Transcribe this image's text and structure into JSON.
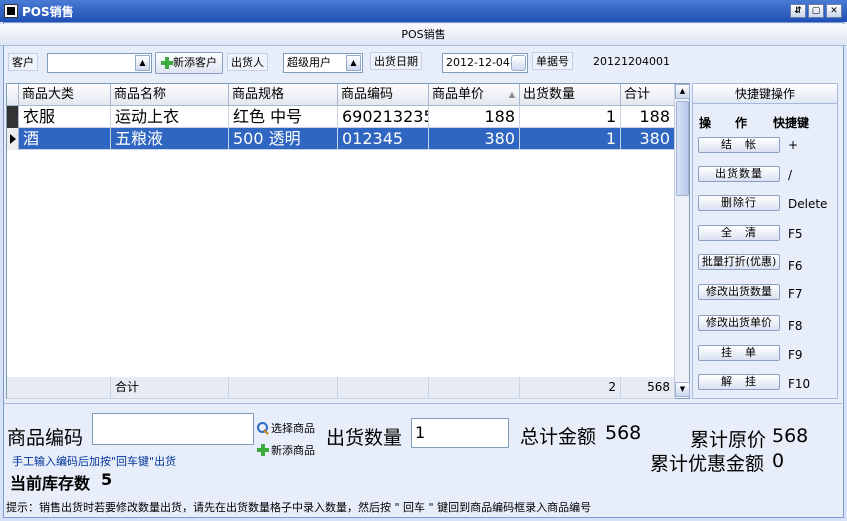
{
  "window": {
    "title": "POS销售",
    "controls": [
      "⇵",
      "▢",
      "✕"
    ]
  },
  "header": {
    "title": "POS销售"
  },
  "toolbar": {
    "customer_label": "客户",
    "customer_value": "",
    "add_customer_label": "新添客户",
    "shipper_label": "出货人",
    "shipper_value": "超级用户",
    "date_label": "出货日期",
    "date_value": "2012-12-04",
    "doc_no_label": "单据号",
    "doc_no_value": "20121204001"
  },
  "grid": {
    "columns": [
      "商品大类",
      "商品名称",
      "商品规格",
      "商品编码",
      "商品单价",
      "出货数量",
      "合计"
    ],
    "sort_indicator": "▲",
    "rows": [
      {
        "category": "衣服",
        "name": "运动上衣",
        "spec": "红色 中号",
        "code": "690213235",
        "price": "188",
        "qty": "1",
        "total": "188",
        "selected": false
      },
      {
        "category": "酒",
        "name": "五粮液",
        "spec": "500 透明",
        "code": "012345",
        "price": "380",
        "qty": "1",
        "total": "380",
        "selected": true
      }
    ],
    "summary": {
      "label": "合计",
      "qty": "2",
      "total": "568"
    }
  },
  "shortcuts": {
    "title": "快捷键操作",
    "col_action": "操　　作",
    "col_key": "快捷键",
    "items": [
      {
        "label": "结　帐",
        "key": "+"
      },
      {
        "label": "出货数量",
        "key": "/"
      },
      {
        "label": "删除行",
        "key": "Delete"
      },
      {
        "label": "全　清",
        "key": "F5"
      },
      {
        "label": "批量打折(优惠)",
        "key": "F6"
      },
      {
        "label": "修改出货数量",
        "key": "F7"
      },
      {
        "label": "修改出货单价",
        "key": "F8"
      },
      {
        "label": "挂　单",
        "key": "F9"
      },
      {
        "label": "解　挂",
        "key": "F10"
      }
    ]
  },
  "bottom": {
    "code_label": "商品编码",
    "code_value": "",
    "select_goods": "选择商品",
    "add_goods": "新添商品",
    "qty_label": "出货数量",
    "qty_value": "1",
    "total_label": "总计金额",
    "total_value": "568",
    "orig_label": "累计原价",
    "orig_value": "568",
    "discount_label": "累计优惠金额",
    "discount_value": "0",
    "hint": "手工输入编码后加按\"回车键\"出货",
    "stock_label": "当前库存数",
    "stock_value": "5",
    "tip": "提示：销售出货时若要修改数量出货，请先在出货数量格子中录入数量，然后按 \" 回车 \" 键回到商品编码框录入商品编号"
  }
}
